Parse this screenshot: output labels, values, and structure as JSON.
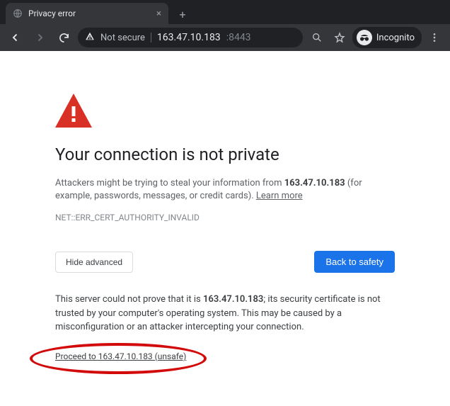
{
  "tab": {
    "title": "Privacy error",
    "close": "×",
    "new": "+"
  },
  "nav": {
    "back": "←",
    "forward": "→",
    "reload": "⟳"
  },
  "omnibox": {
    "not_secure": "Not secure",
    "url_host": "163.47.10.183",
    "url_port": ":8443"
  },
  "right": {
    "incognito": "Incognito"
  },
  "page": {
    "heading": "Your connection is not private",
    "p1_a": "Attackers might be trying to steal your information from ",
    "p1_host": "163.47.10.183",
    "p1_b": " (for example, passwords, messages, or credit cards). ",
    "learn_more": "Learn more",
    "error_code": "NET::ERR_CERT_AUTHORITY_INVALID",
    "hide_advanced": "Hide advanced",
    "back_to_safety": "Back to safety",
    "p2_a": "This server could not prove that it is ",
    "p2_host": "163.47.10.183",
    "p2_b": "; its security certificate is not trusted by your computer's operating system. This may be caused by a misconfiguration or an attacker intercepting your connection.",
    "proceed": "Proceed to 163.47.10.183 (unsafe)"
  }
}
